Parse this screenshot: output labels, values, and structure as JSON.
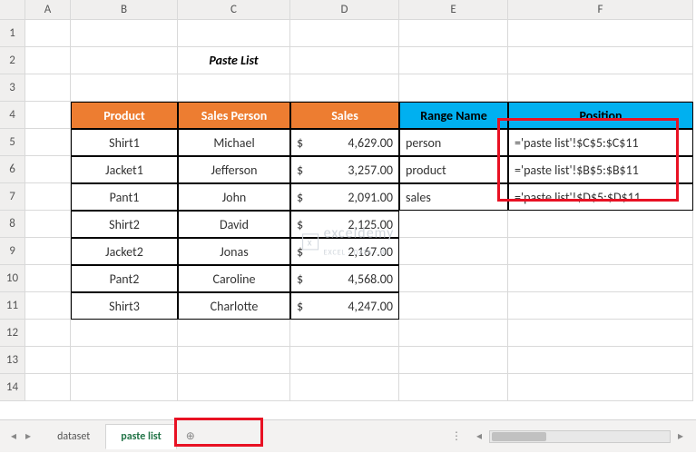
{
  "columns": [
    "A",
    "B",
    "C",
    "D",
    "E",
    "F"
  ],
  "rows": [
    "1",
    "2",
    "3",
    "4",
    "5",
    "6",
    "7",
    "8",
    "9",
    "10",
    "11",
    "12",
    "13",
    "14"
  ],
  "title": "Paste List",
  "headers": {
    "product": "Product",
    "salesPerson": "Sales Person",
    "sales": "Sales",
    "rangeName": "Range Name",
    "position": "Position"
  },
  "table": [
    {
      "product": "Shirt1",
      "person": "Michael",
      "sales": "4,629.00",
      "range": "person",
      "pos": "='paste list'!$C$5:$C$11"
    },
    {
      "product": "Jacket1",
      "person": "Jefferson",
      "sales": "3,257.00",
      "range": "product",
      "pos": "='paste list'!$B$5:$B$11"
    },
    {
      "product": "Pant1",
      "person": "John",
      "sales": "2,091.00",
      "range": "sales",
      "pos": "='paste list'!$D$5:$D$11"
    },
    {
      "product": "Shirt2",
      "person": "David",
      "sales": "2,125.00"
    },
    {
      "product": "Jacket2",
      "person": "Jonas",
      "sales": "2,167.00"
    },
    {
      "product": "Pant2",
      "person": "Caroline",
      "sales": "4,568.00"
    },
    {
      "product": "Shirt3",
      "person": "Charlotte",
      "sales": "4,247.00"
    }
  ],
  "currency": "$",
  "tabs": {
    "dataset": "dataset",
    "pasteList": "paste list"
  },
  "watermark": {
    "brand": "exceldemy",
    "tag": "EXCEL · DATA · BI",
    "icon": "x"
  },
  "addIcon": "⊕"
}
